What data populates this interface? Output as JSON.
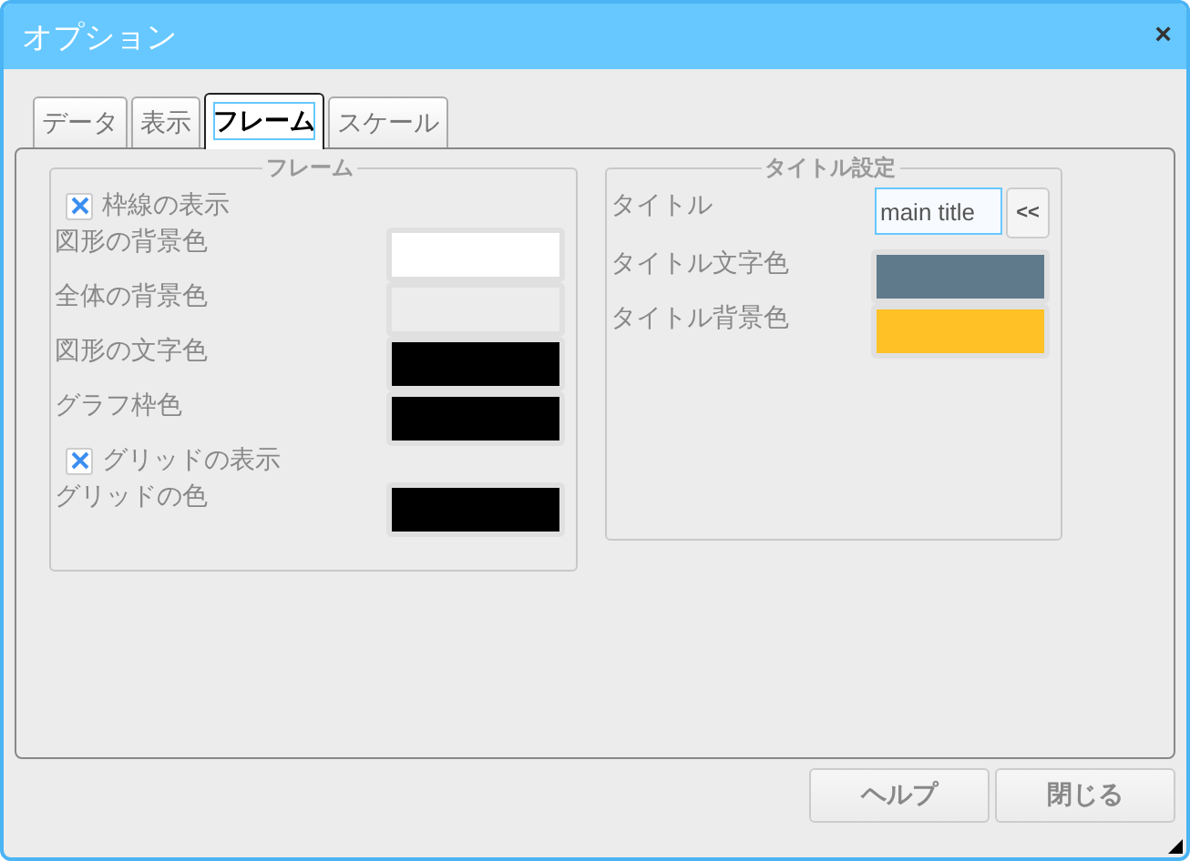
{
  "window": {
    "title": "オプション",
    "close": "×"
  },
  "tabs": [
    {
      "label": "データ",
      "selected": false
    },
    {
      "label": "表示",
      "selected": false
    },
    {
      "label": "フレーム",
      "selected": true
    },
    {
      "label": "スケール",
      "selected": false
    }
  ],
  "frame_group": {
    "legend": "フレーム",
    "rows": [
      {
        "kind": "checkbox",
        "label": "枠線の表示",
        "checked": true
      },
      {
        "kind": "color",
        "label": "図形の背景色",
        "color": "#ffffff"
      },
      {
        "kind": "color",
        "label": "全体の背景色",
        "color": "#ececec"
      },
      {
        "kind": "color",
        "label": "図形の文字色",
        "color": "#000000"
      },
      {
        "kind": "color",
        "label": "グラフ枠色",
        "color": "#000000"
      },
      {
        "kind": "checkbox",
        "label": "グリッドの表示",
        "checked": true
      },
      {
        "kind": "color",
        "label": "グリッドの色",
        "color": "#000000"
      }
    ]
  },
  "title_group": {
    "legend": "タイトル設定",
    "rows": [
      {
        "kind": "text",
        "label": "タイトル",
        "value": "main title",
        "button": "<<"
      },
      {
        "kind": "color",
        "label": "タイトル文字色",
        "color": "#5f7a8b"
      },
      {
        "kind": "color",
        "label": "タイトル背景色",
        "color": "#ffc125"
      }
    ]
  },
  "buttons": [
    "ヘルプ",
    "閉じる"
  ]
}
